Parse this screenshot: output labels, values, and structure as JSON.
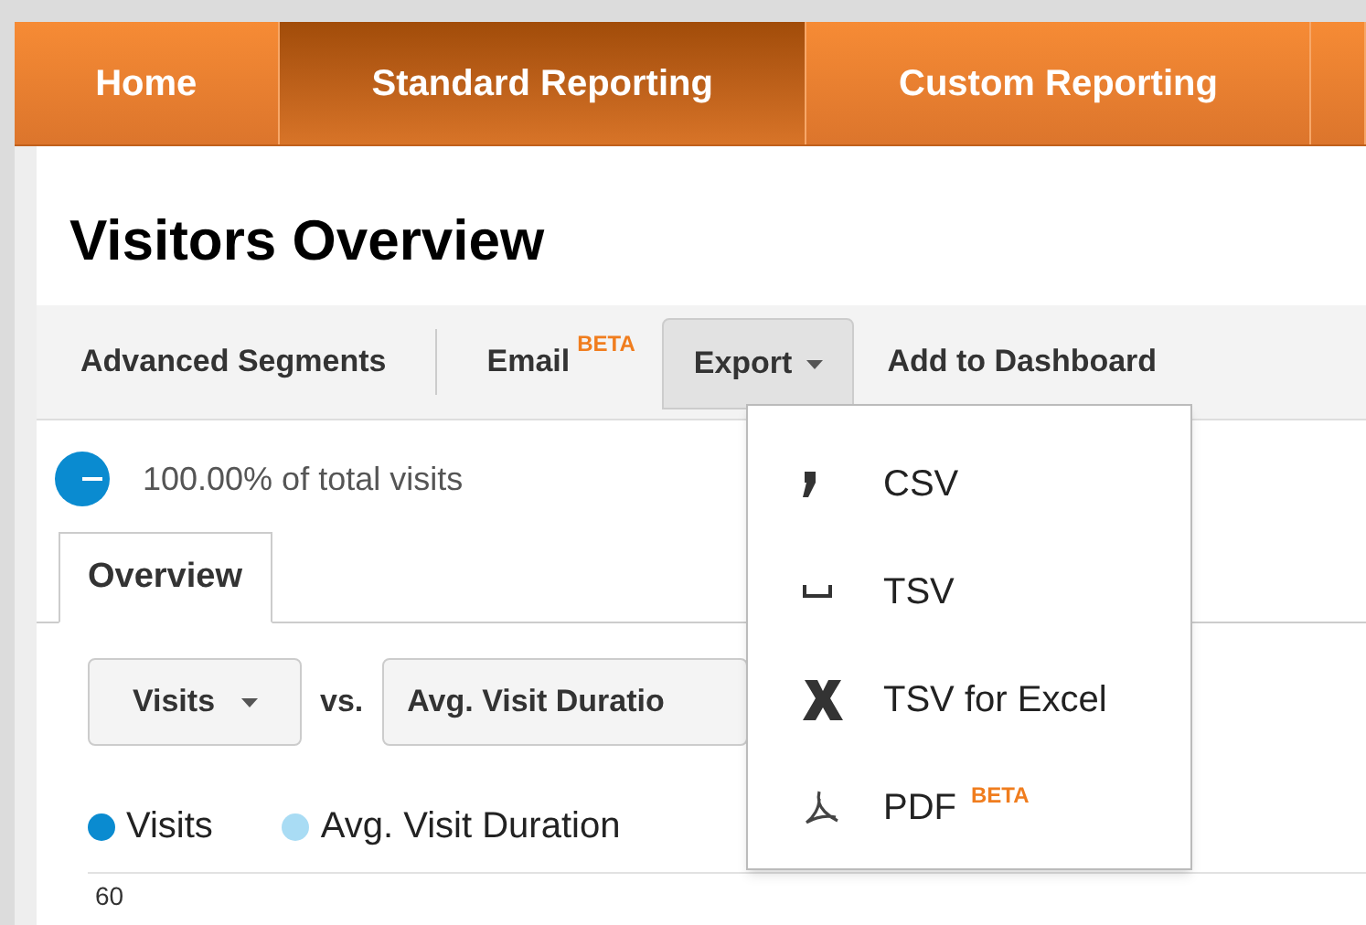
{
  "nav_tabs": [
    {
      "label": "Home",
      "selected": false
    },
    {
      "label": "Standard Reporting",
      "selected": true
    },
    {
      "label": "Custom Reporting",
      "selected": false
    },
    {
      "selected": false
    }
  ],
  "page_title": "Visitors Overview",
  "toolbar": {
    "advanced_segments": "Advanced Segments",
    "email": "Email",
    "email_badge": "BETA",
    "export": "Export",
    "add_to_dashboard": "Add to Dashboard"
  },
  "export_menu": [
    {
      "kind": "comma",
      "label": "CSV"
    },
    {
      "kind": "space",
      "label": "TSV"
    },
    {
      "kind": "excel",
      "label": "TSV for Excel"
    },
    {
      "kind": "pdf",
      "label": "PDF",
      "badge": "BETA"
    }
  ],
  "segment": {
    "text": "100.00% of total visits"
  },
  "view_tabs": [
    {
      "label": "Overview",
      "selected": true
    }
  ],
  "metric_selects": {
    "primary": "Visits",
    "vs": "vs.",
    "secondary": "Avg. Visit Duratio"
  },
  "legend": [
    {
      "label": "Visits",
      "color": "#0a8bd0"
    },
    {
      "label": "Avg. Visit Duration",
      "color": "#a9dcf4"
    }
  ],
  "chart": {
    "y_label": "60"
  }
}
